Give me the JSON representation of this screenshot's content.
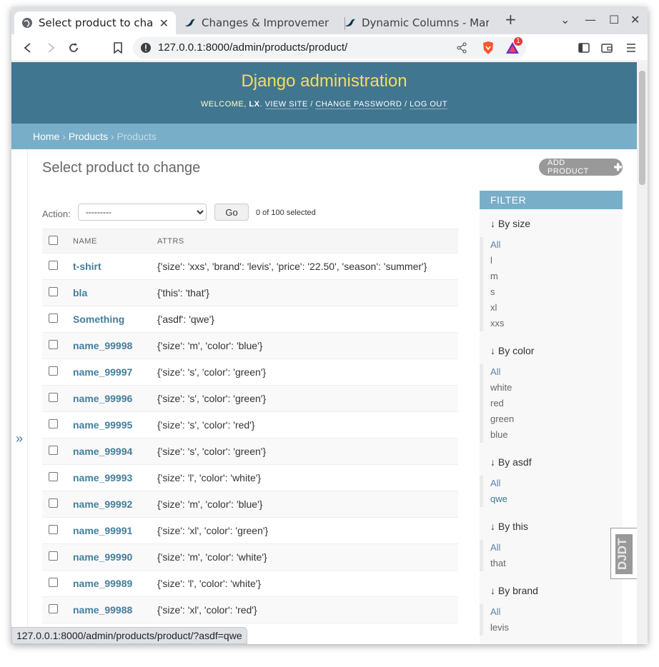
{
  "browser": {
    "tabs": [
      {
        "title": "Select product to change",
        "active": true
      },
      {
        "title": "Changes & Improvements in",
        "active": false
      },
      {
        "title": "Dynamic Columns - MariaDB",
        "active": false
      }
    ],
    "new_tab": "+",
    "url": "127.0.0.1:8000/admin/products/product/",
    "status_url": "127.0.0.1:8000/admin/products/product/?asdf=qwe",
    "shield_badge": "1"
  },
  "site": {
    "brand": "Django administration",
    "welcome": "WELCOME,",
    "user": "LX",
    "view_site": "VIEW SITE",
    "change_password": "CHANGE PASSWORD",
    "log_out": "LOG OUT",
    "sep": "/"
  },
  "breadcrumbs": [
    "Home",
    "Products",
    "Products"
  ],
  "nav_toggle": "»",
  "page_title": "Select product to change",
  "add_button": "ADD PRODUCT",
  "actions": {
    "label": "Action:",
    "selected": "---------",
    "go": "Go",
    "count": "0 of 100 selected"
  },
  "table": {
    "headers": [
      "NAME",
      "ATTRS"
    ],
    "rows": [
      {
        "name": "t-shirt",
        "attrs": "{'size': 'xxs', 'brand': 'levis', 'price': '22.50', 'season': 'summer'}"
      },
      {
        "name": "bla",
        "attrs": "{'this': 'that'}"
      },
      {
        "name": "Something",
        "attrs": "{'asdf': 'qwe'}"
      },
      {
        "name": "name_99998",
        "attrs": "{'size': 'm', 'color': 'blue'}"
      },
      {
        "name": "name_99997",
        "attrs": "{'size': 's', 'color': 'green'}"
      },
      {
        "name": "name_99996",
        "attrs": "{'size': 's', 'color': 'green'}"
      },
      {
        "name": "name_99995",
        "attrs": "{'size': 's', 'color': 'red'}"
      },
      {
        "name": "name_99994",
        "attrs": "{'size': 's', 'color': 'green'}"
      },
      {
        "name": "name_99993",
        "attrs": "{'size': 'l', 'color': 'white'}"
      },
      {
        "name": "name_99992",
        "attrs": "{'size': 'm', 'color': 'blue'}"
      },
      {
        "name": "name_99991",
        "attrs": "{'size': 'xl', 'color': 'green'}"
      },
      {
        "name": "name_99990",
        "attrs": "{'size': 'm', 'color': 'white'}"
      },
      {
        "name": "name_99989",
        "attrs": "{'size': 'l', 'color': 'white'}"
      },
      {
        "name": "name_99988",
        "attrs": "{'size': 'xl', 'color': 'red'}"
      }
    ]
  },
  "filter": {
    "title": "FILTER",
    "sections": [
      {
        "title": "↓ By size",
        "items": [
          "All",
          "l",
          "m",
          "s",
          "xl",
          "xxs"
        ]
      },
      {
        "title": "↓ By color",
        "items": [
          "All",
          "white",
          "red",
          "green",
          "blue"
        ]
      },
      {
        "title": "↓ By asdf",
        "items": [
          "All",
          "qwe"
        ]
      },
      {
        "title": "↓ By this",
        "items": [
          "All",
          "that"
        ]
      },
      {
        "title": "↓ By brand",
        "items": [
          "All",
          "levis"
        ]
      }
    ]
  },
  "djdt": "DJDT"
}
